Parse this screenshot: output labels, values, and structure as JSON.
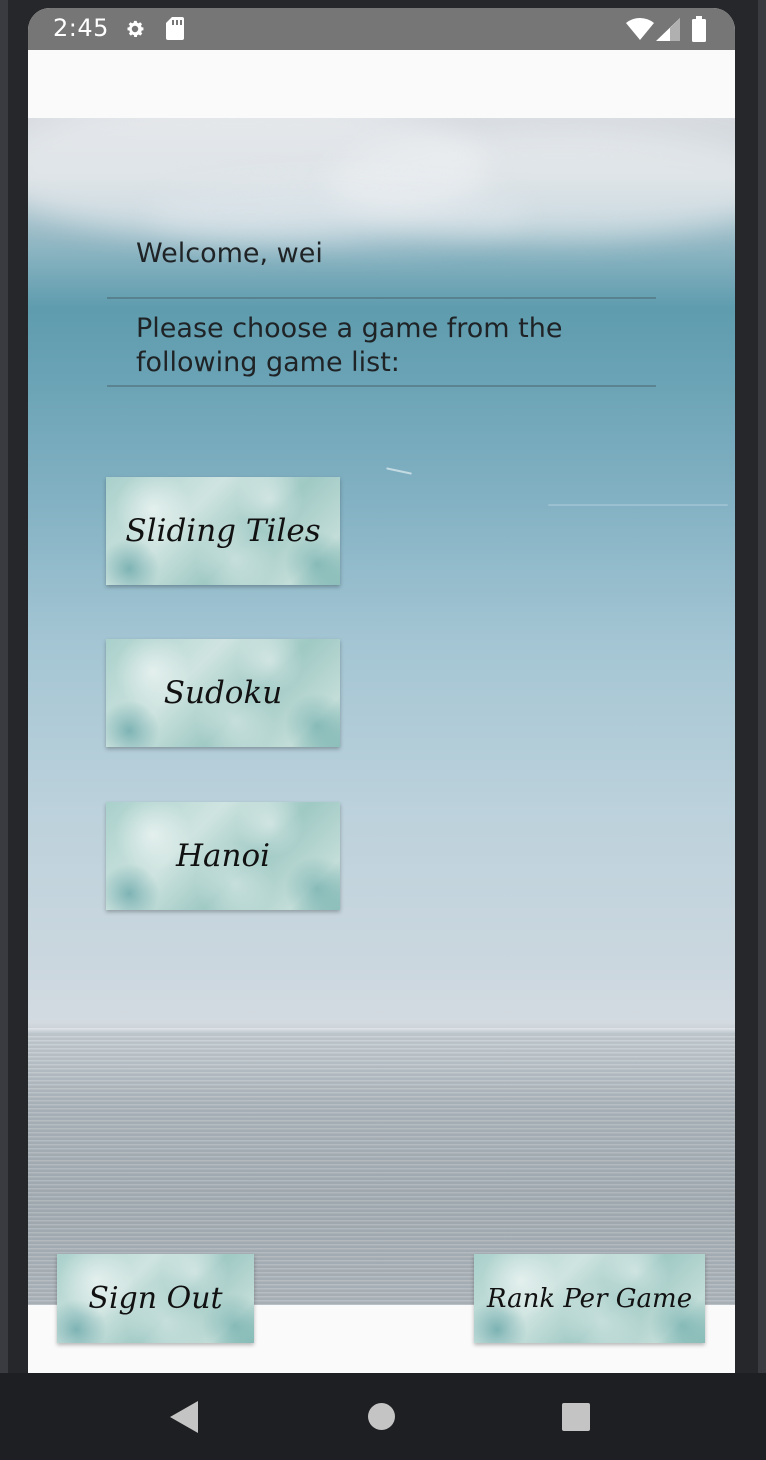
{
  "status_bar": {
    "time": "2:45",
    "icons": [
      "gear-icon",
      "sd-card-icon",
      "wifi-icon",
      "signal-icon",
      "battery-icon"
    ]
  },
  "main": {
    "welcome": "Welcome, wei",
    "prompt": "Please choose a game from the following game list:",
    "games": [
      {
        "label": "Sliding Tiles"
      },
      {
        "label": "Sudoku"
      },
      {
        "label": "Hanoi"
      }
    ]
  },
  "footer": {
    "sign_out_label": "Sign Out",
    "rank_label": "Rank Per Game"
  },
  "nav_bar": {
    "icons": [
      "back-icon",
      "home-icon",
      "recents-icon"
    ]
  },
  "colors": {
    "status_bar": "#767676",
    "app_bar": "#fafafa",
    "nav_bar": "#1e1f22",
    "button_tint": "#a9d0cb"
  }
}
